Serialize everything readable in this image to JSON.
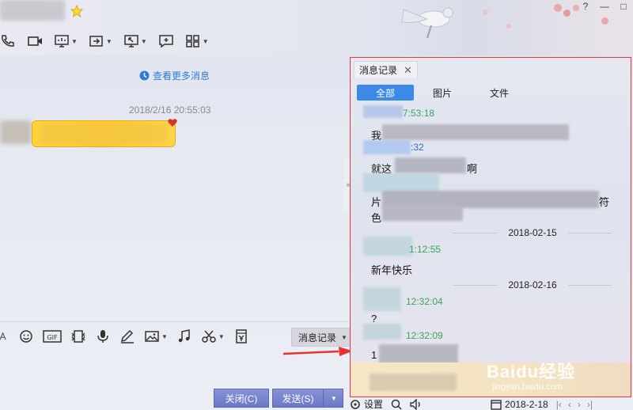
{
  "window": {
    "controls": [
      "?",
      "—",
      "□"
    ]
  },
  "toolbar": {
    "icons": [
      "phone-icon",
      "video-icon",
      "screen-share-icon",
      "transfer-file-icon",
      "remote-desktop-icon",
      "add-app-icon",
      "apps-grid-icon"
    ]
  },
  "chat": {
    "more_messages": "查看更多消息",
    "timestamp": "2018/2/16 20:55:03"
  },
  "input_toolbar": {
    "icons": [
      "font-icon",
      "emoji-icon",
      "gif-icon",
      "magic-icon",
      "mic-icon",
      "pen-icon",
      "image-icon",
      "music-icon",
      "scissors-icon",
      "red-packet-icon"
    ],
    "history_button": "消息记录"
  },
  "buttons": {
    "close": "关闭(C)",
    "send": "发送(S)"
  },
  "history_panel": {
    "tab_title": "消息记录",
    "filters": [
      "全部",
      "图片",
      "文件"
    ],
    "active_filter": "全部",
    "entries": [
      {
        "time": "7:53:18"
      },
      {
        "text_prefix": "我",
        "time_blue": ":32"
      },
      {
        "text": "就这",
        "text_end": "啊"
      },
      {
        "text": "片",
        "text_end": "符"
      },
      {
        "text": "色"
      }
    ],
    "date1": "2018-02-15",
    "entry2_time": "1:12:55",
    "entry2_text": "新年快乐",
    "date2": "2018-02-16",
    "entry3_time": "12:32:04",
    "entry3_text": "?",
    "entry4_time": "12:32:09",
    "entry4_text": "1"
  },
  "bottom_bar": {
    "settings": "设置",
    "date": "2018-2-18"
  },
  "watermark": {
    "brand": "Baidu经验",
    "url": "jingyan.baidu.com"
  }
}
